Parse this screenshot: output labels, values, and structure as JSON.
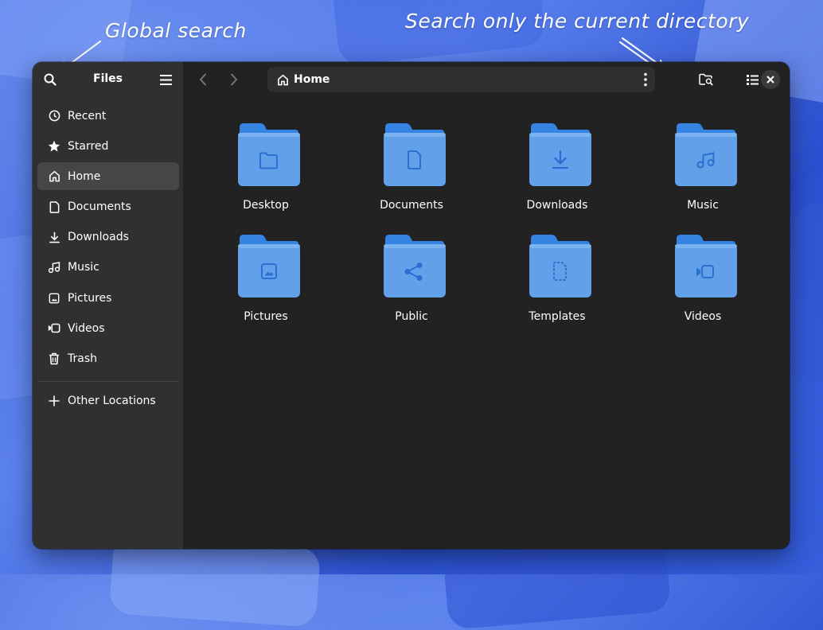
{
  "annotations": {
    "global_search": "Global search",
    "current_dir_search": "Search only the current directory"
  },
  "window": {
    "app_title": "Files",
    "colors": {
      "accent_folder": "#62a0ea",
      "folder_dark": "#3584e4",
      "sidebar_bg": "#303030",
      "content_bg": "#222222"
    }
  },
  "sidebar": {
    "search_icon": "search-icon",
    "menu_icon": "hamburger-menu-icon",
    "items": [
      {
        "label": "Recent",
        "icon": "clock-icon"
      },
      {
        "label": "Starred",
        "icon": "star-icon"
      },
      {
        "label": "Home",
        "icon": "home-icon",
        "active": true
      },
      {
        "label": "Documents",
        "icon": "document-icon"
      },
      {
        "label": "Downloads",
        "icon": "download-icon"
      },
      {
        "label": "Music",
        "icon": "music-note-icon"
      },
      {
        "label": "Pictures",
        "icon": "image-icon"
      },
      {
        "label": "Videos",
        "icon": "video-camera-icon"
      },
      {
        "label": "Trash",
        "icon": "trash-icon"
      }
    ],
    "other_locations": {
      "label": "Other Locations",
      "icon": "plus-icon"
    }
  },
  "toolbar": {
    "back_icon": "chevron-left-icon",
    "forward_icon": "chevron-right-icon",
    "path_label": "Home",
    "path_icon": "home-icon",
    "path_menu_icon": "vertical-dots-icon",
    "folder_search_icon": "folder-search-icon",
    "view_icon": "list-view-icon",
    "view_dropdown_icon": "triangle-down-icon",
    "close_icon": "close-icon"
  },
  "files": [
    {
      "name": "Desktop",
      "emblem": "folder-emblem"
    },
    {
      "name": "Documents",
      "emblem": "document-emblem"
    },
    {
      "name": "Downloads",
      "emblem": "download-emblem"
    },
    {
      "name": "Music",
      "emblem": "music-emblem"
    },
    {
      "name": "Pictures",
      "emblem": "image-emblem"
    },
    {
      "name": "Public",
      "emblem": "share-emblem"
    },
    {
      "name": "Templates",
      "emblem": "template-emblem"
    },
    {
      "name": "Videos",
      "emblem": "video-emblem"
    }
  ]
}
